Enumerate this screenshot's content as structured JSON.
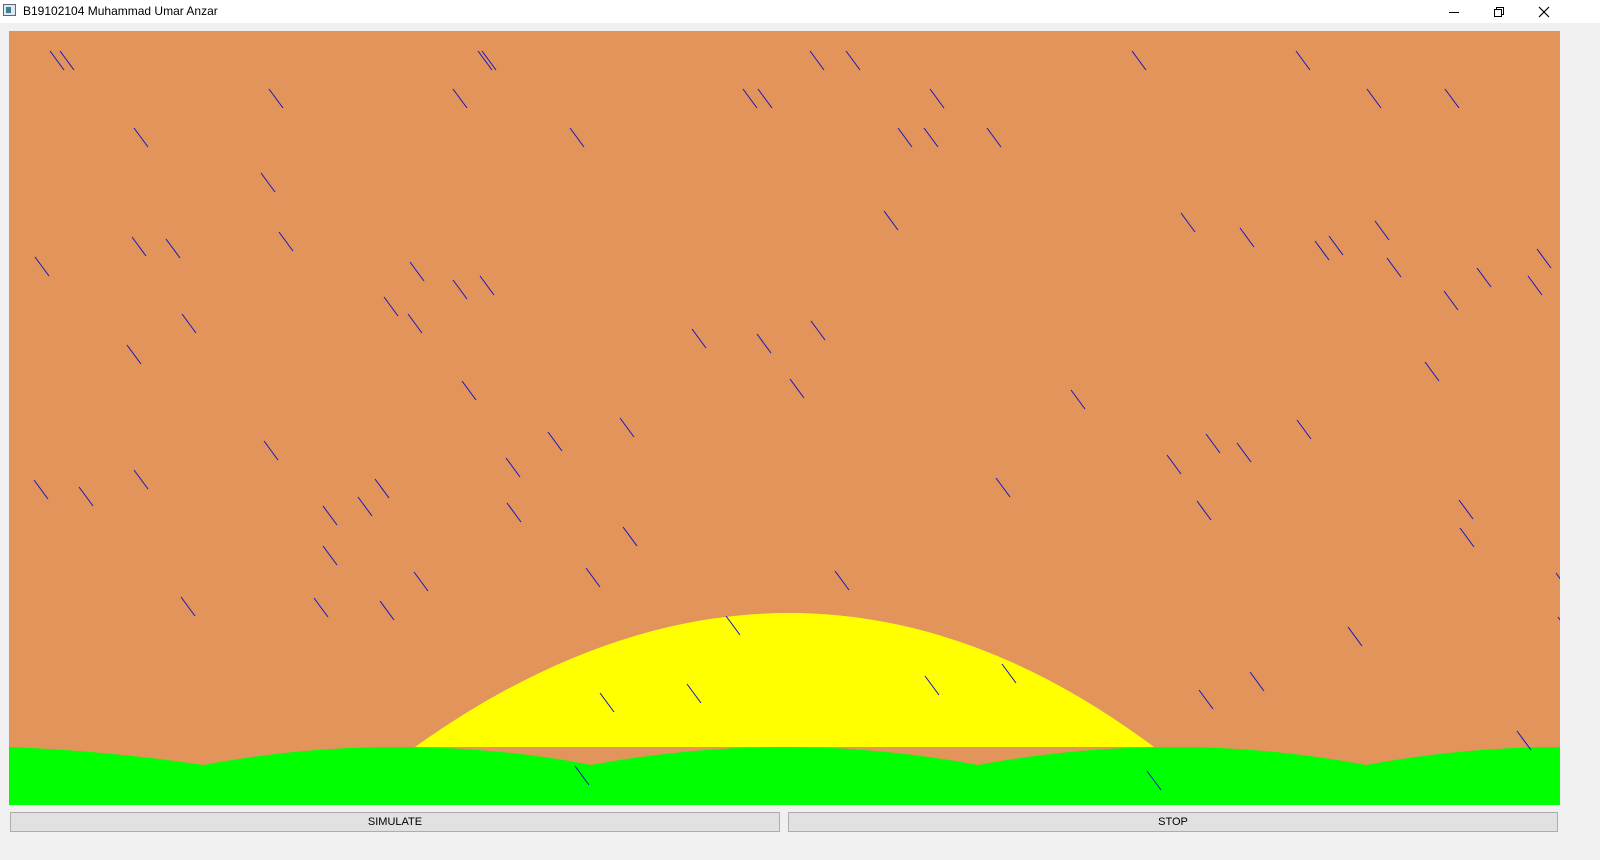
{
  "window": {
    "title": "B19102104 Muhammad Umar Anzar",
    "icons": {
      "app": "app-window-icon",
      "minimize": "minimize-icon",
      "restore": "restore-icon",
      "close": "close-icon"
    }
  },
  "scene": {
    "sky_color": "#e2945a",
    "sun_color": "#ffff00",
    "grass_color": "#00ff00",
    "rain_color": "#1414c8"
  },
  "controls": {
    "simulate_label": "SIMULATE",
    "stop_label": "STOP"
  }
}
